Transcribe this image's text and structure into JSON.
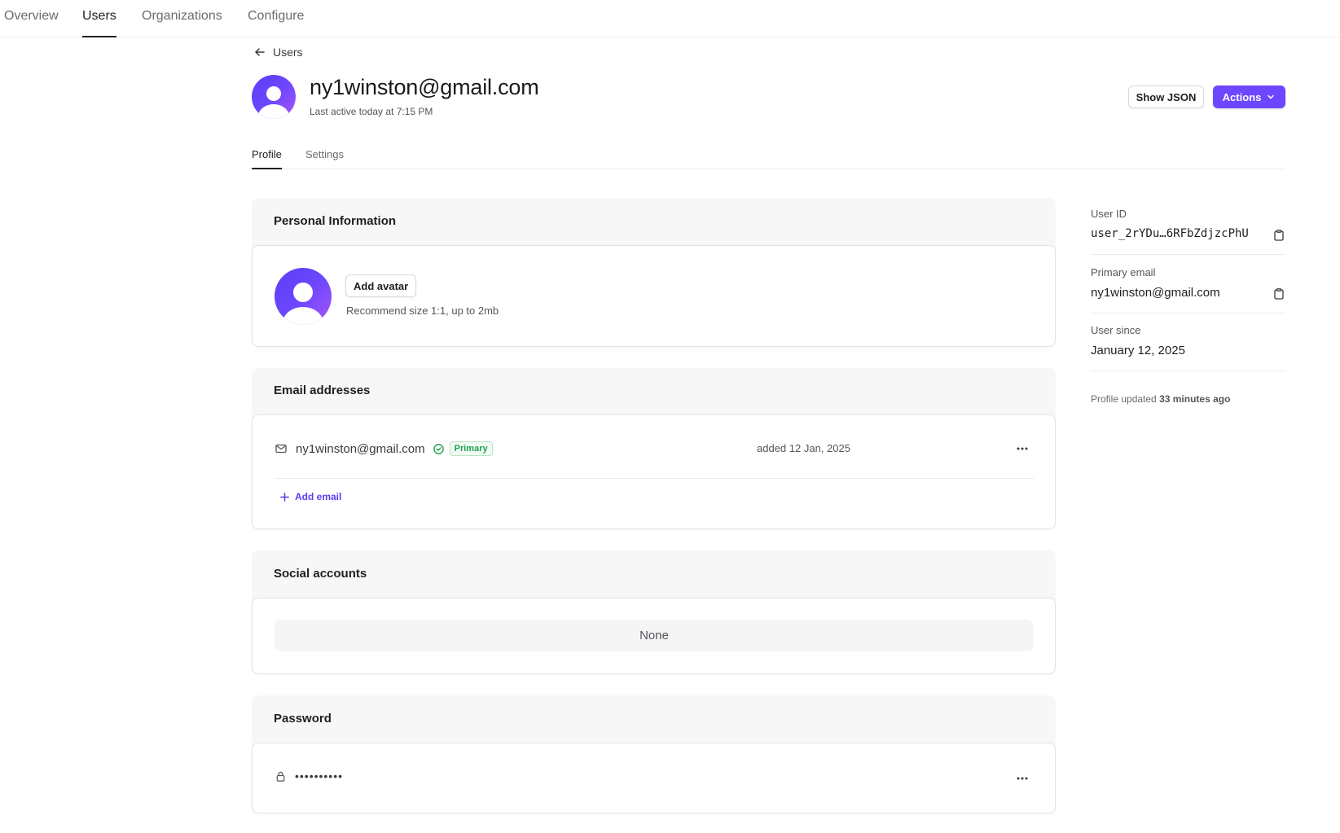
{
  "nav": {
    "items": [
      "Overview",
      "Users",
      "Organizations",
      "Configure"
    ],
    "active": "Users"
  },
  "breadcrumb": {
    "back_label": "Users"
  },
  "header": {
    "title": "ny1winston@gmail.com",
    "subtitle": "Last active today at 7:15 PM",
    "show_json_label": "Show JSON",
    "actions_label": "Actions"
  },
  "tabs": {
    "profile": "Profile",
    "settings": "Settings",
    "active": "Profile"
  },
  "personal": {
    "title": "Personal Information",
    "add_avatar_label": "Add avatar",
    "hint": "Recommend size 1:1, up to 2mb"
  },
  "emails": {
    "title": "Email addresses",
    "items": [
      {
        "address": "ny1winston@gmail.com",
        "badge": "Primary",
        "added": "added 12 Jan, 2025",
        "verified": true
      }
    ],
    "add_label": "Add email"
  },
  "social": {
    "title": "Social accounts",
    "empty": "None"
  },
  "password": {
    "title": "Password",
    "masked": "••••••••••"
  },
  "sidebar": {
    "user_id_label": "User ID",
    "user_id": "user_2rYDu…6RFbZdjzcPhU",
    "primary_email_label": "Primary email",
    "primary_email": "ny1winston@gmail.com",
    "user_since_label": "User since",
    "user_since": "January 12, 2025",
    "updated_prefix": "Profile updated",
    "updated_value": "33 minutes ago"
  },
  "colors": {
    "accent": "#6c47ff",
    "success": "#21a150",
    "panel_bg": "#f7f7f8",
    "border": "#e3e3e7"
  },
  "icons": [
    "arrow-left-icon",
    "chevron-down-icon",
    "mail-icon",
    "check-circle-icon",
    "more-horizontal-icon",
    "plus-icon",
    "lock-icon",
    "clipboard-icon",
    "avatar-placeholder"
  ]
}
